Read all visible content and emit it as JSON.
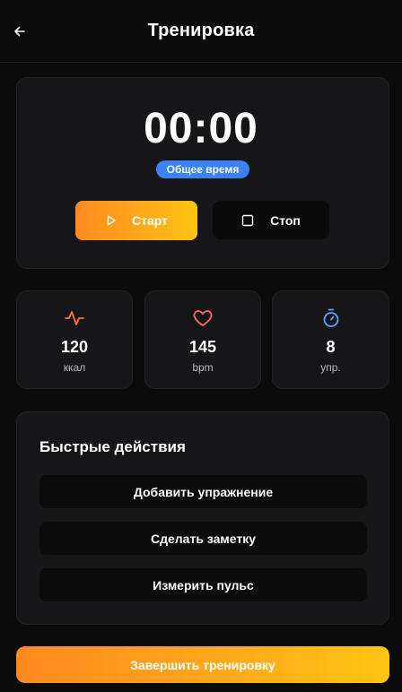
{
  "header": {
    "title": "Тренировка",
    "back_icon": "arrow-left-icon"
  },
  "timer": {
    "value": "00:00",
    "badge": "Общее время",
    "badge_color": "#3b82f6",
    "start_label": "Старт",
    "start_icon": "play-icon",
    "stop_label": "Стоп",
    "stop_icon": "stop-icon"
  },
  "stats": [
    {
      "icon": "activity-icon",
      "value": "120",
      "label": "ккал",
      "color": "#ff7a2f"
    },
    {
      "icon": "heart-icon",
      "value": "145",
      "label": "bpm",
      "color": "#ff6b6b"
    },
    {
      "icon": "stopwatch-icon",
      "value": "8",
      "label": "упр.",
      "color": "#5aa2ff"
    }
  ],
  "quick_actions": {
    "title": "Быстрые действия",
    "items": [
      {
        "label": "Добавить упражнение"
      },
      {
        "label": "Сделать заметку"
      },
      {
        "label": "Измерить пульс"
      }
    ]
  },
  "finish_button": {
    "label": "Завершить тренировку"
  },
  "colors": {
    "accent_start": "#ff8a1f",
    "accent_end": "#ffc512",
    "background": "#0b0b0c",
    "card": "#161618"
  }
}
